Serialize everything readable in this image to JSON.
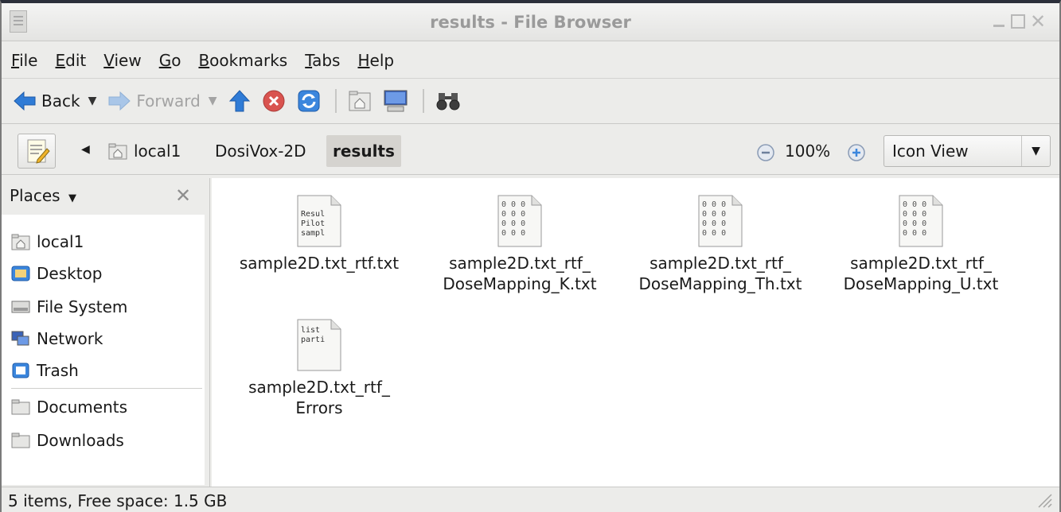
{
  "window": {
    "title": "results - File Browser",
    "buttons": {
      "minimize": "minimize",
      "maximize": "maximize",
      "close": "✕"
    }
  },
  "menubar": {
    "items": [
      "File",
      "Edit",
      "View",
      "Go",
      "Bookmarks",
      "Tabs",
      "Help"
    ]
  },
  "toolbar": {
    "back_label": "Back",
    "forward_label": "Forward",
    "icons": [
      "back-arrow-icon",
      "forward-arrow-icon",
      "up-arrow-icon",
      "stop-icon",
      "reload-icon",
      "home-folder-icon",
      "computer-icon",
      "search-binoculars-icon"
    ]
  },
  "location": {
    "crumbs": [
      "local1",
      "DosiVox-2D",
      "results"
    ],
    "zoom_level": "100%",
    "view_mode": "Icon View"
  },
  "sidebar": {
    "header": "Places",
    "items": [
      {
        "label": "local1",
        "icon": "home-folder-icon"
      },
      {
        "label": "Desktop",
        "icon": "desktop-icon"
      },
      {
        "label": "File System",
        "icon": "drive-icon"
      },
      {
        "label": "Network",
        "icon": "network-icon"
      },
      {
        "label": "Trash",
        "icon": "trash-icon"
      },
      {
        "label": "Documents",
        "icon": "folder-icon"
      },
      {
        "label": "Downloads",
        "icon": "folder-icon"
      }
    ]
  },
  "files": [
    {
      "name_line1": "sample2D.txt_rtf.txt",
      "name_line2": "",
      "preview": [
        "Resul",
        "Pilot",
        "sampl"
      ],
      "kind": "text"
    },
    {
      "name_line1": "sample2D.txt_rtf_",
      "name_line2": "DoseMapping_K.txt",
      "preview": [
        "0 0 0",
        "0 0 0",
        "0 0 0",
        "0 0 0"
      ],
      "kind": "data"
    },
    {
      "name_line1": "sample2D.txt_rtf_",
      "name_line2": "DoseMapping_Th.txt",
      "preview": [
        "0 0 0",
        "0 0 0",
        "0 0 0",
        "0 0 0"
      ],
      "kind": "data"
    },
    {
      "name_line1": "sample2D.txt_rtf_",
      "name_line2": "DoseMapping_U.txt",
      "preview": [
        "0 0 0",
        "0 0 0",
        "0 0 0",
        "0 0 0"
      ],
      "kind": "data"
    },
    {
      "name_line1": "sample2D.txt_rtf_",
      "name_line2": "Errors",
      "preview": [
        "list",
        "parti"
      ],
      "kind": "text"
    }
  ],
  "status": {
    "text": "5 items, Free space: 1.5 GB"
  },
  "colors": {
    "window_bg": "#ececea",
    "content_bg": "#ffffff",
    "title_text": "#9a9a9a",
    "active_crumb": "#d5d3cf",
    "arrow_blue": "#2f7bd6",
    "stop_red": "#d9534f"
  }
}
